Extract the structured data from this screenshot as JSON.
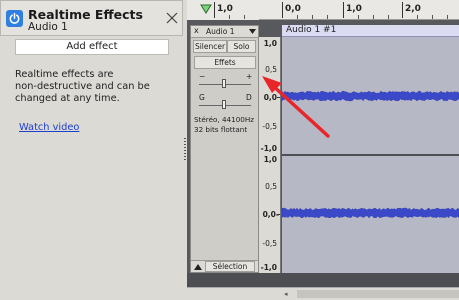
{
  "effects_panel": {
    "title": "Realtime Effects",
    "subtitle": "Audio 1",
    "add_effect_label": "Add effect",
    "description_lines": [
      "Realtime effects are",
      "non-destructive and can be",
      "changed at any time."
    ],
    "watch_video_label": "Watch video",
    "power_color": "#2f7fe0",
    "link_color": "#1c3fd0"
  },
  "timeline": {
    "ruler_labels": [
      "1,0",
      "0,0",
      "1,0",
      "2,0"
    ]
  },
  "track": {
    "name": "Audio 1",
    "close_label": "x",
    "mute_label": "Silencer",
    "solo_label": "Solo",
    "effects_label": "Effets",
    "gain_minus": "−",
    "gain_plus": "+",
    "pan_left": "G",
    "pan_right": "D",
    "info_line1": "Stéréo, 44100Hz",
    "info_line2": "32 bits flottant",
    "select_label": "Sélection",
    "clip_name": "Audio 1 #1",
    "waveform_color": "#3b48c8",
    "clip_bg_color": "#b6b8c6"
  },
  "vertical_scale": {
    "top_channel": [
      "1,0",
      "0,5",
      "0,0",
      "-0,5",
      "-1,0"
    ],
    "bottom_channel": [
      "1,0",
      "0,5",
      "0,0-",
      "-0,5",
      "-1,0"
    ]
  },
  "annotation": {
    "arrow_color": "#e8262a"
  }
}
